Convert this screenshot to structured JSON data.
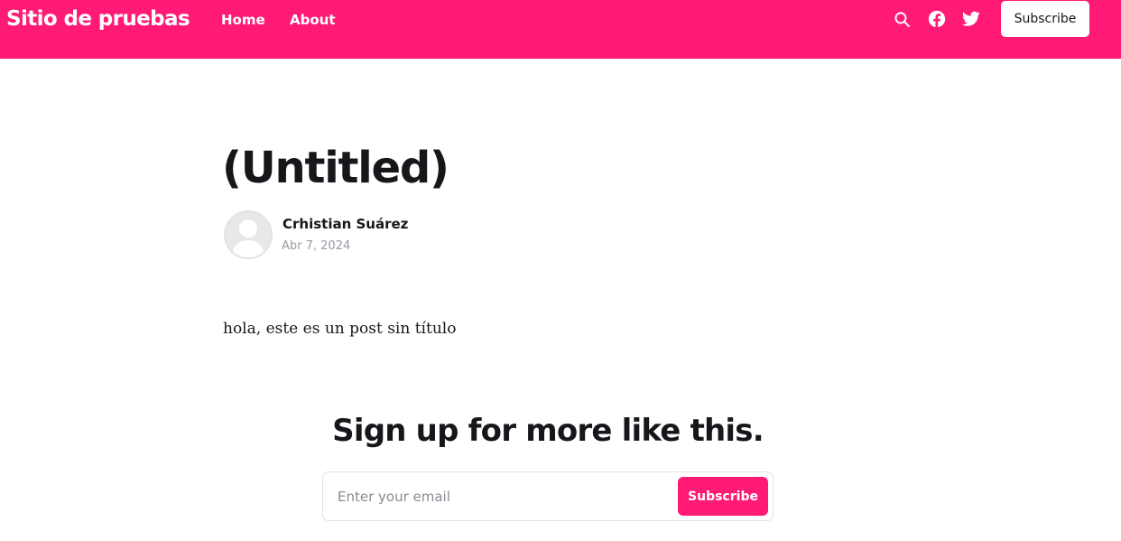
{
  "theme": {
    "accent": "#ff1a75",
    "text": "#15171a",
    "muted": "#999aa3",
    "background": "#ffffff"
  },
  "header": {
    "site_title": "Sitio de pruebas",
    "nav": [
      {
        "label": "Home"
      },
      {
        "label": "About"
      }
    ],
    "icons": [
      "search-icon",
      "facebook-icon",
      "twitter-icon"
    ],
    "subscribe_label": "Subscribe"
  },
  "post": {
    "title": "(Untitled)",
    "author": "Crhistian Suárez",
    "date": "Abr 7, 2024",
    "content": "hola, este es un post sin título"
  },
  "signup": {
    "title": "Sign up for more like this.",
    "email_placeholder": "Enter your email",
    "button_label": "Subscribe"
  }
}
